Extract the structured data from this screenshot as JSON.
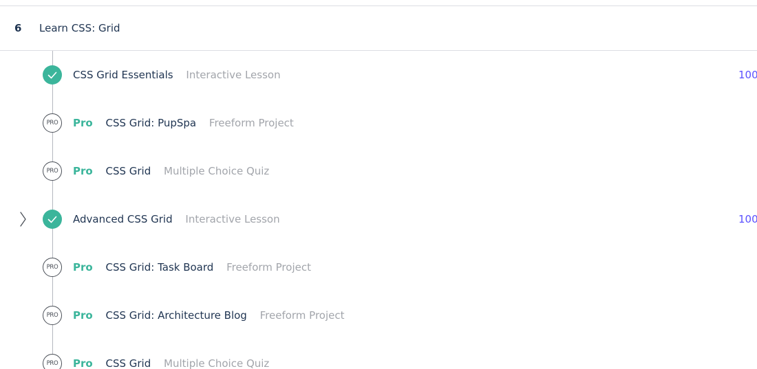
{
  "module": {
    "number": "6",
    "title": "Learn CSS: Grid"
  },
  "items": [
    {
      "status": "completed",
      "pro": "",
      "title": "CSS Grid Essentials",
      "type": "Interactive Lesson",
      "score": "100"
    },
    {
      "status": "locked",
      "pro": "Pro",
      "title": "CSS Grid: PupSpa",
      "type": "Freeform Project",
      "score": ""
    },
    {
      "status": "locked",
      "pro": "Pro",
      "title": "CSS Grid",
      "type": "Multiple Choice Quiz",
      "score": ""
    },
    {
      "status": "completed",
      "pro": "",
      "title": "Advanced CSS Grid",
      "type": "Interactive Lesson",
      "score": "100"
    },
    {
      "status": "locked",
      "pro": "Pro",
      "title": "CSS Grid: Task Board",
      "type": "Freeform Project",
      "score": ""
    },
    {
      "status": "locked",
      "pro": "Pro",
      "title": "CSS Grid: Architecture Blog",
      "type": "Freeform Project",
      "score": ""
    },
    {
      "status": "locked",
      "pro": "Pro",
      "title": "CSS Grid",
      "type": "Multiple Choice Quiz",
      "score": ""
    }
  ],
  "pro_icon_label": "PRO",
  "icons": {
    "completed": "check-circle-icon",
    "locked": "pro-lock-icon",
    "expand": "chevron-right-icon"
  },
  "colors": {
    "accent_green": "#3bb59b",
    "score_purple": "#5a50ff",
    "text_dark": "#1f3451",
    "text_muted": "#a2a5ab",
    "divider": "#dcdee3"
  }
}
